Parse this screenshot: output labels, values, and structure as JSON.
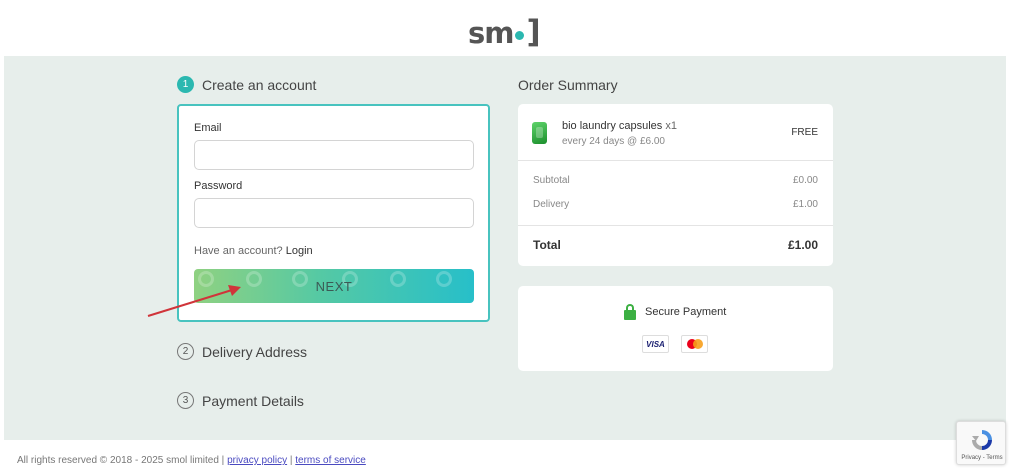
{
  "brand": {
    "logo_text": "sm",
    "logo_end": "]",
    "dot_color": "#2bb8b0"
  },
  "steps": [
    {
      "number": "1",
      "label": "Create an account"
    },
    {
      "number": "2",
      "label": "Delivery Address"
    },
    {
      "number": "3",
      "label": "Payment Details"
    }
  ],
  "form": {
    "email_label": "Email",
    "email_value": "",
    "password_label": "Password",
    "password_value": "",
    "have_account": "Have an account?",
    "login_link": "Login",
    "next_label": "NEXT"
  },
  "summary": {
    "title": "Order Summary",
    "item_name": "bio laundry capsules",
    "item_qty": "x1",
    "item_schedule": "every 24 days @ £6.00",
    "item_price": "FREE",
    "subtotal_label": "Subtotal",
    "subtotal_value": "£0.00",
    "delivery_label": "Delivery",
    "delivery_value": "£1.00",
    "total_label": "Total",
    "total_value": "£1.00"
  },
  "payment": {
    "secure_label": "Secure Payment",
    "visa_label": "VISA",
    "lock_icon": "lock-icon",
    "card_icons": [
      "visa-icon",
      "mastercard-icon"
    ]
  },
  "footer": {
    "copyright": "All rights reserved © 2018 - 2025 smol limited |",
    "privacy": "privacy policy",
    "divider": "|",
    "terms": "terms of service"
  },
  "recaptcha": {
    "text": "Privacy - Terms"
  },
  "colors": {
    "accent": "#2bb8b0",
    "background": "#e7eeeb",
    "arrow": "#d0343a",
    "lock": "#3cb043"
  }
}
